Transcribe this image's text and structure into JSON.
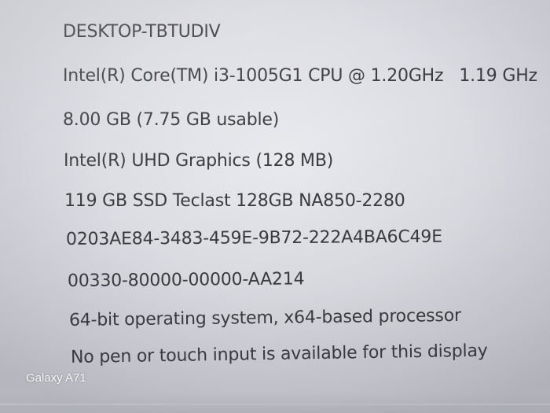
{
  "device_specs": {
    "device_name": "DESKTOP-TBTUDIV",
    "processor_model": "Intel(R) Core(TM) i3-1005G1 CPU @ 1.20GHz",
    "processor_speed": "1.19 GHz",
    "installed_ram": "8.00 GB (7.75 GB usable)",
    "graphics": "Intel(R) UHD Graphics (128 MB)",
    "storage": "119 GB SSD Teclast 128GB NA850-2280",
    "device_id": "0203AE84-3483-459E-9B72-222A4BA6C49E",
    "product_id": "00330-80000-00000-AA214",
    "system_type": "64-bit operating system, x64-based processor",
    "pen_and_touch": "No pen or touch input is available for this display"
  },
  "watermark": {
    "text": "Galaxy A71"
  },
  "colors": {
    "text": "#3b3b3f",
    "background": "#e4e5ea"
  }
}
